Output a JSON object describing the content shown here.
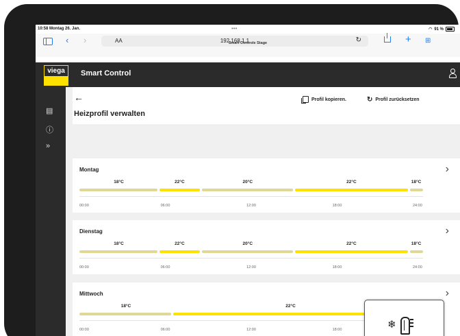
{
  "statusbar": {
    "time": "10:58 Montag 26. Jan.",
    "dots": "•••",
    "battery": "91 %"
  },
  "browser": {
    "text_size": "AA",
    "url": "192.168.1.1",
    "page_title": "Smart Controle Stage"
  },
  "app": {
    "brand": "viega",
    "title": "Smart Control"
  },
  "header": {
    "back": "←",
    "title": "Heizprofil verwalten",
    "copy_label": "Profil kopieren.",
    "reset_label": "Profil zurücksetzen"
  },
  "time_axis": [
    "00:00",
    "06:00",
    "12:00",
    "18:00",
    "24:00"
  ],
  "days": [
    {
      "name": "Montag",
      "segments": [
        {
          "start": 0,
          "end": 5.5,
          "temp": "18°C",
          "level": "low"
        },
        {
          "start": 5.5,
          "end": 8.5,
          "temp": "22°C",
          "level": "high"
        },
        {
          "start": 8.5,
          "end": 15,
          "temp": "20°C",
          "level": "low"
        },
        {
          "start": 15,
          "end": 23,
          "temp": "22°C",
          "level": "high"
        },
        {
          "start": 23,
          "end": 24,
          "temp": "18°C",
          "level": "low"
        }
      ]
    },
    {
      "name": "Dienstag",
      "segments": [
        {
          "start": 0,
          "end": 5.5,
          "temp": "18°C",
          "level": "low"
        },
        {
          "start": 5.5,
          "end": 8.5,
          "temp": "22°C",
          "level": "high"
        },
        {
          "start": 8.5,
          "end": 15,
          "temp": "20°C",
          "level": "low"
        },
        {
          "start": 15,
          "end": 23,
          "temp": "22°C",
          "level": "high"
        },
        {
          "start": 23,
          "end": 24,
          "temp": "18°C",
          "level": "low"
        }
      ]
    },
    {
      "name": "Mittwoch",
      "segments": [
        {
          "start": 0,
          "end": 6.5,
          "temp": "18°C",
          "level": "low"
        },
        {
          "start": 6.5,
          "end": 23,
          "temp": "22°C",
          "level": "high"
        },
        {
          "start": 23,
          "end": 24,
          "temp": "18°C",
          "level": "low"
        }
      ]
    }
  ],
  "colors": {
    "accent": "#ffe100",
    "low": "#e1d796",
    "dark": "#2b2b2b"
  },
  "icons": {
    "rail": [
      "clipboard-icon",
      "info-icon",
      "expand-icon"
    ],
    "widget": [
      "snowflake-icon",
      "thermometer-icon"
    ]
  }
}
